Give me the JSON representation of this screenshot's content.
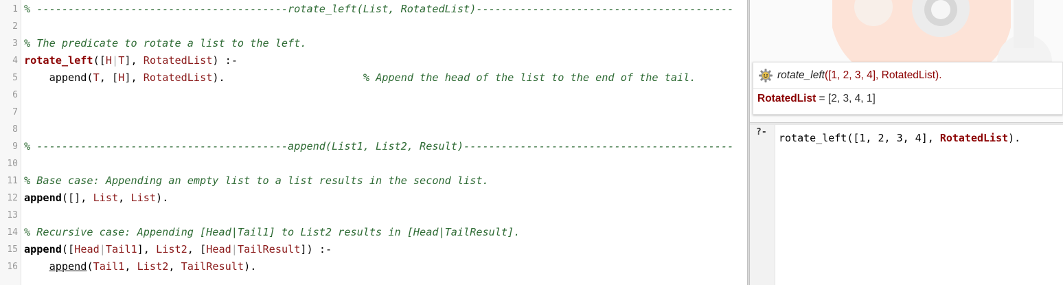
{
  "editor": {
    "lines": [
      {
        "num": "1",
        "tokens": [
          {
            "t": "% ----------------------------------------rotate_left(List, RotatedList)-----------------------------------------",
            "c": "cmt"
          }
        ]
      },
      {
        "num": "2",
        "tokens": []
      },
      {
        "num": "3",
        "tokens": [
          {
            "t": "% The predicate to rotate a list to the left.",
            "c": "cmt"
          }
        ]
      },
      {
        "num": "4",
        "tokens": [
          {
            "t": "rotate_left",
            "c": "head"
          },
          {
            "t": "([",
            "c": "punc"
          },
          {
            "t": "H",
            "c": "var"
          },
          {
            "t": "|",
            "c": "bar"
          },
          {
            "t": "T",
            "c": "var"
          },
          {
            "t": "], ",
            "c": "punc"
          },
          {
            "t": "RotatedList",
            "c": "var"
          },
          {
            "t": ") :-",
            "c": "punc"
          }
        ]
      },
      {
        "num": "5",
        "tokens": [
          {
            "t": "    append(",
            "c": "punc"
          },
          {
            "t": "T",
            "c": "var"
          },
          {
            "t": ", [",
            "c": "punc"
          },
          {
            "t": "H",
            "c": "var"
          },
          {
            "t": "], ",
            "c": "punc"
          },
          {
            "t": "RotatedList",
            "c": "var"
          },
          {
            "t": ").                      ",
            "c": "punc"
          },
          {
            "t": "% Append the head of the list to the end of the tail.",
            "c": "cmt"
          }
        ]
      },
      {
        "num": "6",
        "tokens": []
      },
      {
        "num": "7",
        "tokens": []
      },
      {
        "num": "8",
        "tokens": []
      },
      {
        "num": "9",
        "tokens": [
          {
            "t": "% ----------------------------------------append(List1, List2, Result)-------------------------------------------",
            "c": "cmt"
          }
        ]
      },
      {
        "num": "10",
        "tokens": []
      },
      {
        "num": "11",
        "tokens": [
          {
            "t": "% Base case: Appending an empty list to a list results in the second list.",
            "c": "cmt"
          }
        ]
      },
      {
        "num": "12",
        "tokens": [
          {
            "t": "append",
            "c": "call"
          },
          {
            "t": "([], ",
            "c": "punc"
          },
          {
            "t": "List",
            "c": "var"
          },
          {
            "t": ", ",
            "c": "punc"
          },
          {
            "t": "List",
            "c": "var"
          },
          {
            "t": ").",
            "c": "punc"
          }
        ]
      },
      {
        "num": "13",
        "tokens": []
      },
      {
        "num": "14",
        "tokens": [
          {
            "t": "% Recursive case: Appending [Head|Tail1] to List2 results in [Head|TailResult].",
            "c": "cmt"
          }
        ]
      },
      {
        "num": "15",
        "tokens": [
          {
            "t": "append",
            "c": "call"
          },
          {
            "t": "([",
            "c": "punc"
          },
          {
            "t": "Head",
            "c": "var"
          },
          {
            "t": "|",
            "c": "bar"
          },
          {
            "t": "Tail1",
            "c": "var"
          },
          {
            "t": "], ",
            "c": "punc"
          },
          {
            "t": "List2",
            "c": "var"
          },
          {
            "t": ", [",
            "c": "punc"
          },
          {
            "t": "Head",
            "c": "var"
          },
          {
            "t": "|",
            "c": "bar"
          },
          {
            "t": "TailResult",
            "c": "var"
          },
          {
            "t": "]) :-",
            "c": "punc"
          }
        ]
      },
      {
        "num": "16",
        "tokens": [
          {
            "t": "    ",
            "c": "punc"
          },
          {
            "t": "append",
            "c": "udef"
          },
          {
            "t": "(",
            "c": "punc"
          },
          {
            "t": "Tail1",
            "c": "var"
          },
          {
            "t": ", ",
            "c": "punc"
          },
          {
            "t": "List2",
            "c": "var"
          },
          {
            "t": ", ",
            "c": "punc"
          },
          {
            "t": "TailResult",
            "c": "var"
          },
          {
            "t": ").",
            "c": "punc"
          }
        ]
      }
    ]
  },
  "results": {
    "query_predicate": "rotate_left",
    "query_args": "([1, 2, 3, 4], RotatedList).",
    "answer_var": "RotatedList",
    "answer_eq": " = [2, 3, 4, 1]"
  },
  "console": {
    "prompt": "?-",
    "input_pre": "rotate_left([1, 2, 3, 4], ",
    "input_var": "RotatedList",
    "input_post": ")."
  },
  "icons": {
    "query": "gear-icon",
    "background": "swish-owl-watermark"
  },
  "colors": {
    "comment": "#2e6b34",
    "head": "#8b0000",
    "variable": "#8b1a1a",
    "answer_var": "#8b0000"
  }
}
